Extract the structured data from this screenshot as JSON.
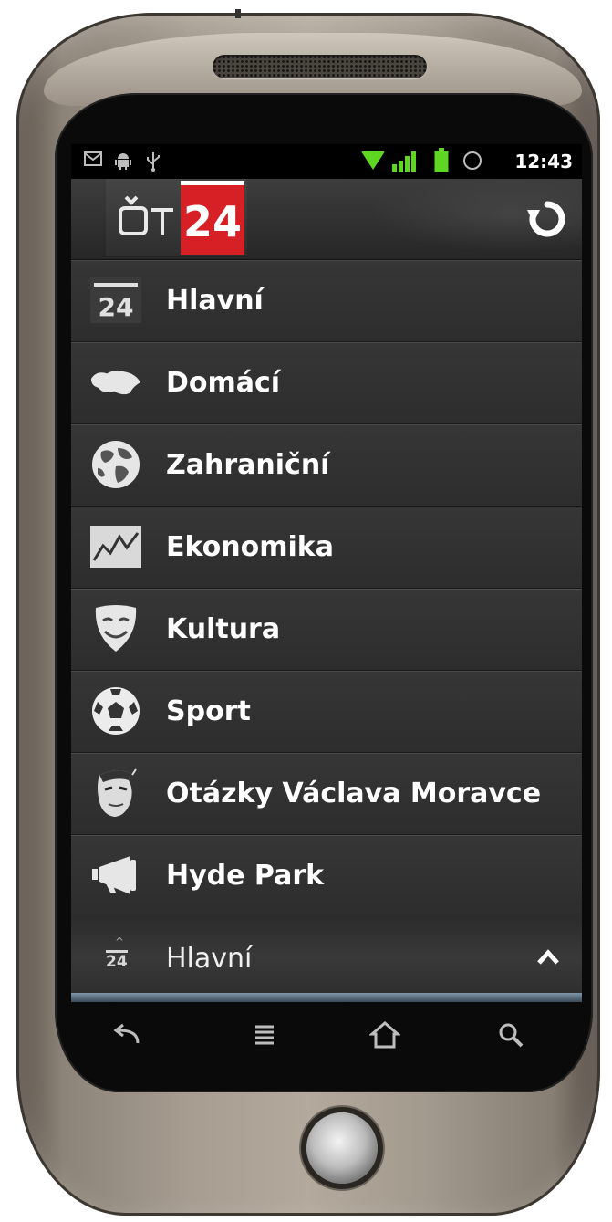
{
  "statusbar": {
    "time": "12:43",
    "icons": [
      "mail-icon",
      "android-icon",
      "usb-icon",
      "wifi-icon",
      "signal-icon",
      "battery-charging-icon",
      "alarm-icon"
    ]
  },
  "app": {
    "logo_ct": "Č",
    "logo_24": "24",
    "refresh_icon": "refresh-icon"
  },
  "menu": {
    "items": [
      {
        "label": "Hlavní",
        "icon": "24-icon"
      },
      {
        "label": "Domácí",
        "icon": "czech-map-icon"
      },
      {
        "label": "Zahraniční",
        "icon": "globe-icon"
      },
      {
        "label": "Ekonomika",
        "icon": "chart-icon"
      },
      {
        "label": "Kultura",
        "icon": "theater-mask-icon"
      },
      {
        "label": "Sport",
        "icon": "soccer-ball-icon"
      },
      {
        "label": "Otázky Václava Moravce",
        "icon": "face-icon"
      },
      {
        "label": "Hyde Park",
        "icon": "megaphone-icon"
      }
    ]
  },
  "bottom": {
    "current_label": "Hlavní",
    "mini_icon_text": "24",
    "expand_icon": "chevron-up-icon"
  },
  "nav": {
    "buttons": [
      "back-icon",
      "menu-icon",
      "home-icon",
      "search-icon"
    ]
  },
  "colors": {
    "accent_red": "#d71f26",
    "status_green": "#5fd622",
    "list_bg": "#2b2b2b"
  }
}
